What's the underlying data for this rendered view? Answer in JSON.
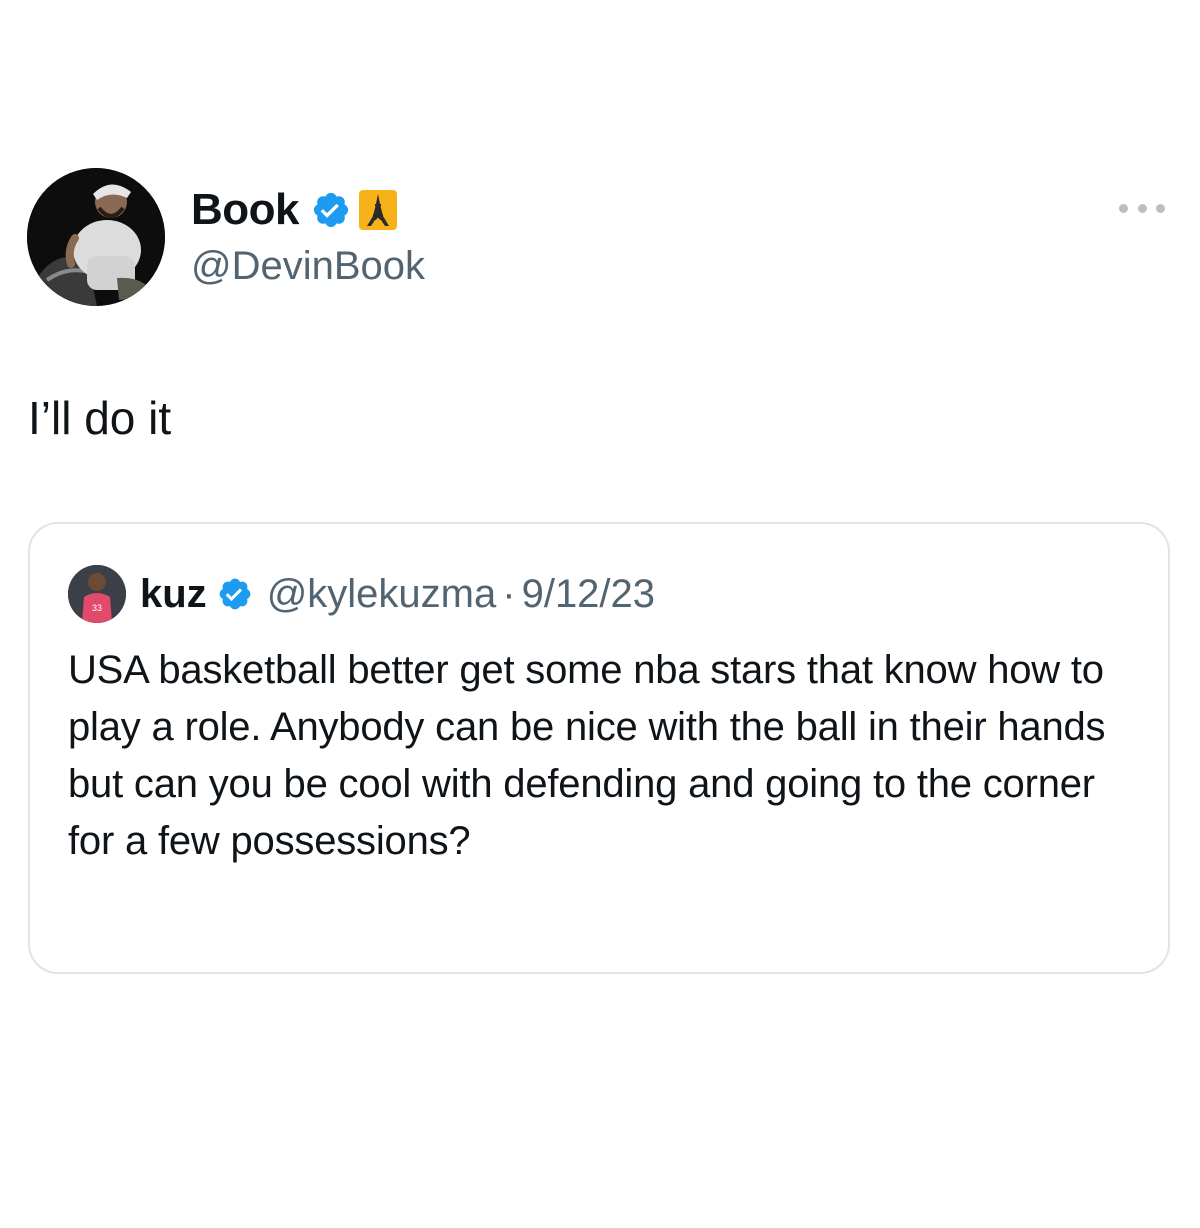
{
  "tweet": {
    "author": {
      "display_name": "Book",
      "handle": "@DevinBook",
      "verified": true,
      "badge_icon": "verified-badge-icon",
      "emoji_icon": "eiffel-tower-emoji-icon",
      "badge_color": "#1d9bf0"
    },
    "more_icon": "more-options-icon",
    "text": "I’ll do it"
  },
  "quote": {
    "author": {
      "display_name": "kuz",
      "handle": "@kylekuzma",
      "verified": true
    },
    "separator": "·",
    "date": "9/12/23",
    "text": "USA basketball better get some nba stars that know how to play a role. Anybody can be nice with the ball in their hands but can you be cool with defending and going to the corner for a few possessions?"
  },
  "colors": {
    "text_primary": "#0f1419",
    "text_secondary": "#536471",
    "border": "#dfe4e8",
    "verified_blue": "#1d9bf0"
  }
}
